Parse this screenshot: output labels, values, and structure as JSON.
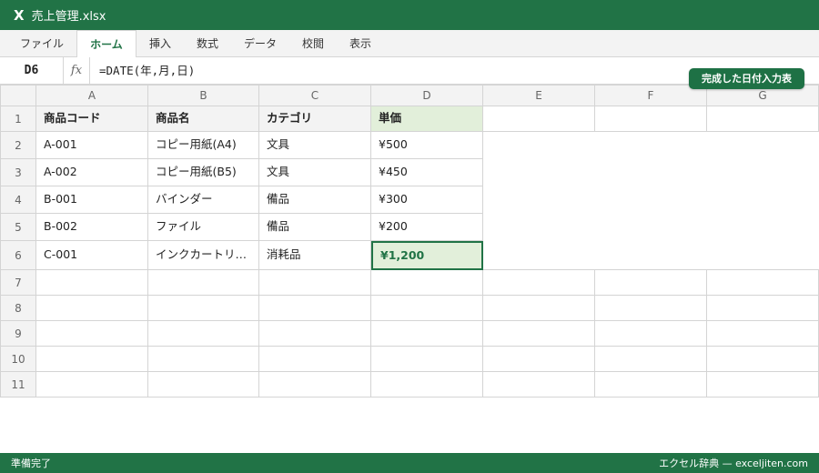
{
  "window": {
    "app_icon": "X",
    "title": "売上管理.xlsx"
  },
  "ribbon": {
    "tabs": [
      "ファイル",
      "ホーム",
      "挿入",
      "数式",
      "データ",
      "校閲",
      "表示"
    ],
    "active_index": 1
  },
  "formula_bar": {
    "name_box": "D6",
    "fx_label": "fx",
    "formula": "=DATE(年,月,日)"
  },
  "badge": "完成した日付入力表",
  "columns": [
    "A",
    "B",
    "C",
    "D",
    "E",
    "F",
    "G"
  ],
  "rows": [
    "1",
    "2",
    "3",
    "4",
    "5",
    "6",
    "7",
    "8",
    "9",
    "10",
    "11"
  ],
  "table": {
    "headers": [
      "商品コード",
      "商品名",
      "カテゴリ",
      "単価"
    ],
    "data": [
      [
        "A-001",
        "コピー用紙(A4)",
        "文具",
        "¥500"
      ],
      [
        "A-002",
        "コピー用紙(B5)",
        "文具",
        "¥450"
      ],
      [
        "B-001",
        "バインダー",
        "備品",
        "¥300"
      ],
      [
        "B-002",
        "ファイル",
        "備品",
        "¥200"
      ],
      [
        "C-001",
        "インクカートリ…",
        "消耗品",
        "¥1,200"
      ]
    ]
  },
  "status": {
    "left": "準備完了",
    "right": "エクセル辞典 — exceljiten.com"
  },
  "colors": {
    "excel_green": "#217346",
    "selected_fill": "#e2efda"
  }
}
